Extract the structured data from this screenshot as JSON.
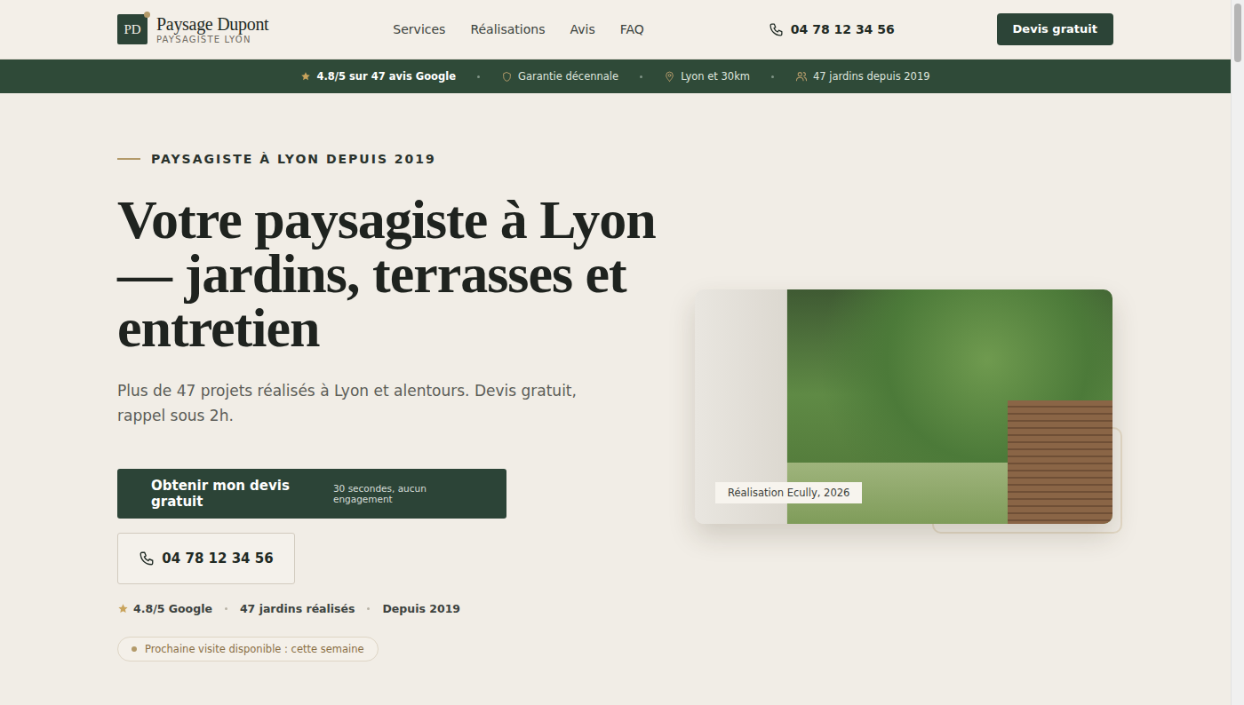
{
  "header": {
    "logo_mark": "PD",
    "brand": "Paysage Dupont",
    "tagline": "PAYSAGISTE LYON",
    "nav": [
      "Services",
      "Réalisations",
      "Avis",
      "FAQ"
    ],
    "phone": "04 78 12 34 56",
    "cta": "Devis gratuit"
  },
  "trust_bar": [
    {
      "text": "4.8/5 sur 47 avis Google",
      "highlighted": true,
      "kind": "rating"
    },
    {
      "text": "Garantie décennale",
      "highlighted": false,
      "kind": "guarantee"
    },
    {
      "text": "Lyon et 30km",
      "highlighted": false,
      "kind": "area"
    },
    {
      "text": "47 jardins depuis 2019",
      "highlighted": false,
      "kind": "projects"
    }
  ],
  "hero": {
    "eyebrow": "PAYSAGISTE À LYON DEPUIS 2019",
    "title": "Votre paysagiste à Lyon — jardins, terrasses et entretien",
    "subtitle": "Plus de 47 projets réalisés à Lyon et alentours. Devis gratuit, rappel sous 2h.",
    "primary_cta": {
      "label": "Obtenir mon devis gratuit",
      "note": "30 secondes, aucun engagement"
    },
    "phone_button": "04 78 12 34 56",
    "stats": [
      {
        "text": "4.8/5 Google",
        "kind": "rating"
      },
      {
        "text": "47 jardins réalisés",
        "kind": "plain"
      },
      {
        "text": "Depuis 2019",
        "kind": "plain"
      }
    ],
    "availability": "Prochaine visite disponible : cette semaine"
  },
  "image": {
    "caption": "Réalisation Ecully, 2026"
  }
}
